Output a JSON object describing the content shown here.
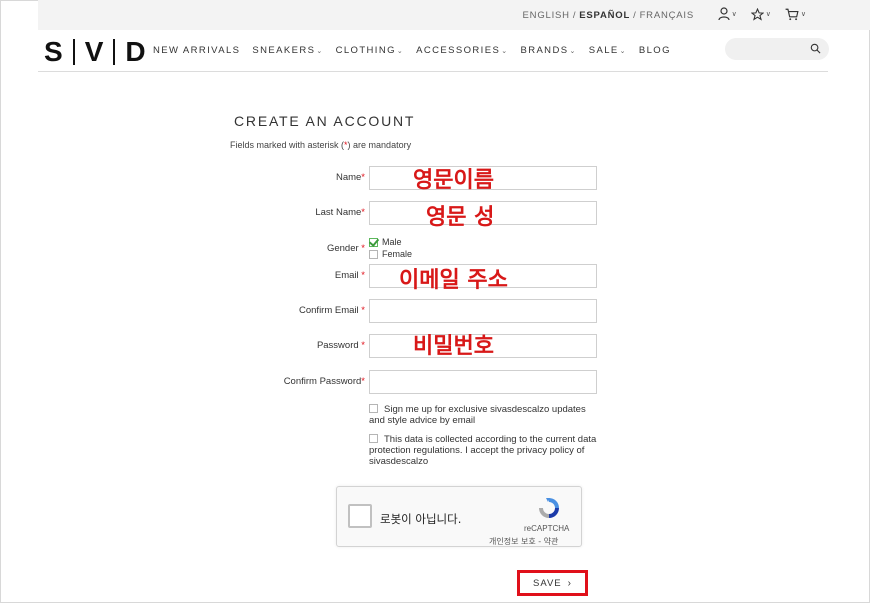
{
  "header": {
    "languages": [
      "ENGLISH",
      "ESPAÑOL",
      "FRANÇAIS"
    ],
    "active_language": "ESPAÑOL",
    "lang_sep": "/",
    "logo": {
      "left": "S",
      "mid": "V",
      "right": "D"
    },
    "menu": [
      {
        "label": "NEW ARRIVALS",
        "dropdown": ""
      },
      {
        "label": "SNEAKERS",
        "dropdown": "⌄"
      },
      {
        "label": "CLOTHING",
        "dropdown": "⌄"
      },
      {
        "label": "ACCESSORIES",
        "dropdown": "⌄"
      },
      {
        "label": "BRANDS",
        "dropdown": "⌄"
      },
      {
        "label": "SALE",
        "dropdown": "⌄"
      },
      {
        "label": "BLOG",
        "dropdown": ""
      }
    ],
    "search": {
      "placeholder": "",
      "icon": "search-icon"
    },
    "icons": [
      "user-icon",
      "star-icon",
      "cart-icon"
    ]
  },
  "form": {
    "title": "CREATE AN ACCOUNT",
    "mandatory_note_pre": "Fields marked with asterisk (",
    "mandatory_note_ast": "*",
    "mandatory_note_post": ") are mandatory",
    "fields": {
      "name": {
        "label": "Name",
        "ast": "*",
        "overlay": "영문이름"
      },
      "last_name": {
        "label": "Last Name",
        "ast": "*",
        "overlay": "영문 성"
      },
      "gender": {
        "label": "Gender ",
        "ast": "*",
        "options": [
          {
            "label": "Male",
            "checked": true
          },
          {
            "label": "Female",
            "checked": false
          }
        ]
      },
      "email": {
        "label": "Email ",
        "ast": "*",
        "overlay": "이메일 주소"
      },
      "confirm_email": {
        "label": "Confirm Email ",
        "ast": "*"
      },
      "password": {
        "label": "Password ",
        "ast": "*",
        "overlay": "비밀번호"
      },
      "confirm_password": {
        "label": "Confirm Password",
        "ast": "*"
      }
    },
    "newsletter": "Sign me up for exclusive sivasdescalzo updates and style advice by email",
    "privacy": "This data is collected according to the current data protection regulations. I accept the privacy policy of sivasdescalzo",
    "captcha": {
      "text": "로봇이 아닙니다.",
      "brand": "reCAPTCHA",
      "links": "개인정보 보호 - 약관"
    },
    "save_label": "SAVE",
    "save_chevron": "›"
  },
  "colors": {
    "asterisk": "#e0101a",
    "overlay_text": "#d81818",
    "save_border": "#e0101a",
    "check": "#3d9b3d"
  }
}
